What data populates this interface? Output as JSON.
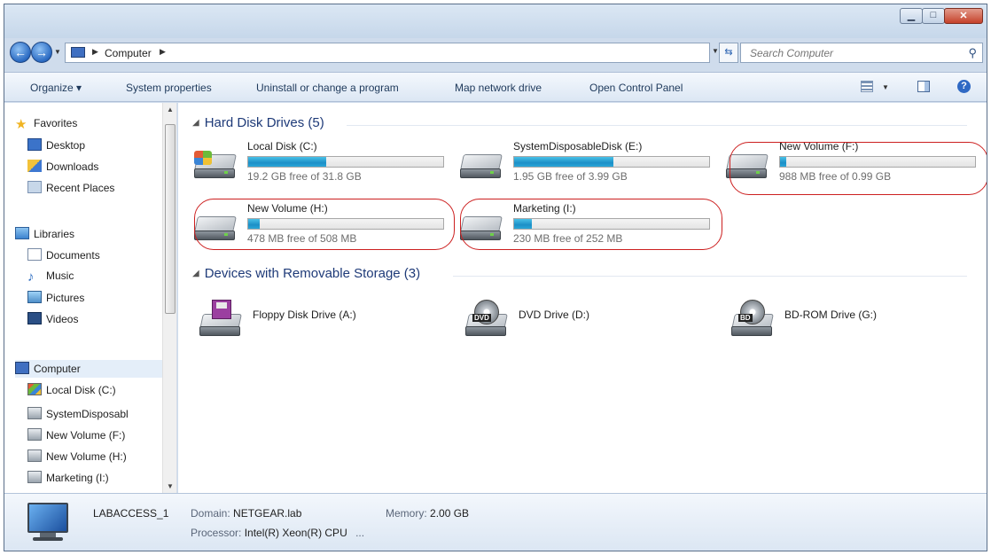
{
  "address_bar": {
    "crumbs": [
      "Computer"
    ],
    "search_placeholder": "Search Computer"
  },
  "command_bar": {
    "organize": "Organize ▾",
    "system_properties": "System properties",
    "uninstall": "Uninstall or change a program",
    "map_drive": "Map network drive",
    "control_panel": "Open Control Panel"
  },
  "nav_pane": {
    "favorites": "Favorites",
    "desktop": "Desktop",
    "downloads": "Downloads",
    "recent": "Recent Places",
    "libraries": "Libraries",
    "documents": "Documents",
    "music": "Music",
    "pictures": "Pictures",
    "videos": "Videos",
    "computer": "Computer",
    "local_disk": "Local Disk (C:)",
    "sys_disk": "SystemDisposabl",
    "vol_f": "New Volume (F:)",
    "vol_h": "New Volume (H:)",
    "marketing": "Marketing (I:)"
  },
  "hard_disks": {
    "header": "Hard Disk Drives (5)",
    "drives": [
      {
        "name": "Local Disk (C:)",
        "free": "19.2 GB free of 31.8 GB",
        "used_fraction": 0.4
      },
      {
        "name": "SystemDisposableDisk (E:)",
        "free": "1.95 GB free of 3.99 GB",
        "used_fraction": 0.51
      },
      {
        "name": "New Volume (F:)",
        "free": "988 MB free of 0.99 GB",
        "used_fraction": 0.03
      },
      {
        "name": "New Volume (H:)",
        "free": "478 MB free of 508 MB",
        "used_fraction": 0.06
      },
      {
        "name": "Marketing (I:)",
        "free": "230 MB free of 252 MB",
        "used_fraction": 0.09
      }
    ]
  },
  "removable": {
    "header": "Devices with Removable Storage (3)",
    "devices": [
      {
        "name": "Floppy Disk Drive (A:)"
      },
      {
        "name": "DVD Drive (D:)",
        "badge": "DVD"
      },
      {
        "name": "BD-ROM Drive (G:)",
        "badge": "BD"
      }
    ]
  },
  "details": {
    "computer_name": "LABACCESS_1",
    "domain_label": "Domain:",
    "domain_value": "NETGEAR.lab",
    "memory_label": "Memory:",
    "memory_value": "2.00 GB",
    "processor_label": "Processor:",
    "processor_value": "Intel(R) Xeon(R) CPU",
    "processor_more": "..."
  },
  "colors": {
    "highlight": "#cc1f1f",
    "usage_bar": "#26a4d9",
    "group_header": "#1e3a78"
  }
}
